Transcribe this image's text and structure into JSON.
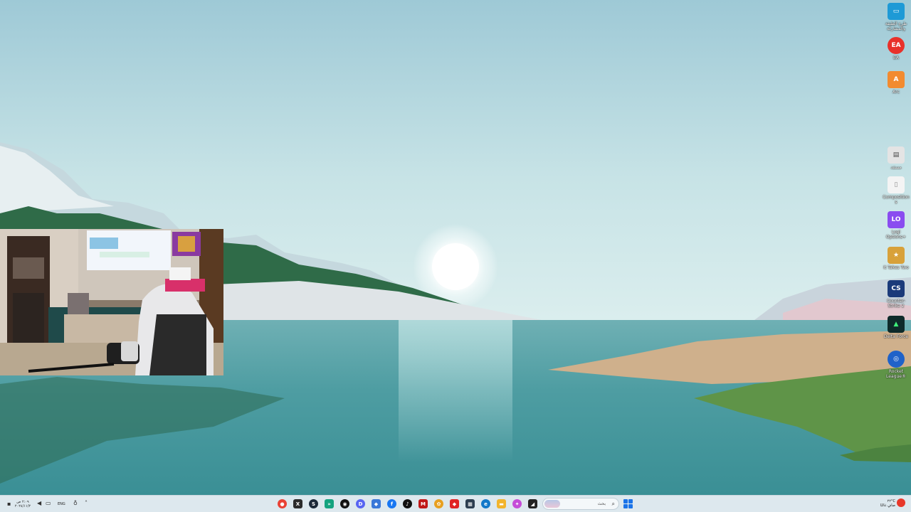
{
  "desktop": {
    "icons": [
      {
        "label": "طرح الطبقة والمشاركة",
        "icon": "monitor-icon",
        "color": "#1e9ad6"
      },
      {
        "label": "EA",
        "icon": "ea-icon",
        "color": "#e8312a"
      },
      {
        "label": "Arc",
        "icon": "arc-icon",
        "color": "#f28b30"
      },
      {
        "label": "مستند",
        "icon": "document-icon",
        "color": "#e4e4e4"
      },
      {
        "label": "Compositions",
        "icon": "file-icon",
        "color": "#f4f4f4"
      },
      {
        "label": "Logi Options+",
        "icon": "logi-icon",
        "color": "#8a4cf0"
      },
      {
        "label": "It Takes Two",
        "icon": "game-icon",
        "color": "#d8a13a"
      },
      {
        "label": "Counter-Strike 2",
        "icon": "cs2-icon",
        "color": "#1b3a7a"
      },
      {
        "label": "Delta Force",
        "icon": "delta-force-icon",
        "color": "#0e2a2a"
      },
      {
        "label": "Rocket League®",
        "icon": "rocket-league-icon",
        "color": "#1f62c9"
      }
    ]
  },
  "taskbar": {
    "language": "ENG",
    "clock": {
      "time": "٢:٠٩ ص",
      "date": "٢٠٢٤/١١/٢"
    },
    "search_placeholder": "بحث",
    "weather": {
      "temp": "٢٢°C",
      "condition": "صافٍ غالبًا"
    },
    "apps": [
      {
        "name": "chrome-app",
        "color": "#e94235",
        "glyph": "●"
      },
      {
        "name": "xbox-app",
        "color": "#2b2b2b",
        "glyph": "X"
      },
      {
        "name": "steam-app",
        "color": "#1b2838",
        "glyph": "S"
      },
      {
        "name": "terminal-app",
        "color": "#14a37f",
        "glyph": "»"
      },
      {
        "name": "github-app",
        "color": "#111111",
        "glyph": "◉"
      },
      {
        "name": "discord-app",
        "color": "#5865f2",
        "glyph": "D"
      },
      {
        "name": "shield-app",
        "color": "#3a78d8",
        "glyph": "◆"
      },
      {
        "name": "facebook-app",
        "color": "#1877f2",
        "glyph": "f"
      },
      {
        "name": "tiktok-app",
        "color": "#111111",
        "glyph": "♪"
      },
      {
        "name": "mcafee-app",
        "color": "#c01818",
        "glyph": "M"
      },
      {
        "name": "photos-app",
        "color": "#e8a020",
        "glyph": "✿"
      },
      {
        "name": "redgem-app",
        "color": "#e02424",
        "glyph": "◆"
      },
      {
        "name": "calculator-app",
        "color": "#2d3e50",
        "glyph": "▦"
      },
      {
        "name": "edge-app",
        "color": "#1479c9",
        "glyph": "e"
      },
      {
        "name": "file-explorer-app",
        "color": "#f2b42c",
        "glyph": "▬"
      },
      {
        "name": "copilot-app",
        "color": "#c54cd8",
        "glyph": "✦"
      },
      {
        "name": "capture-app",
        "color": "#222222",
        "glyph": "◢"
      }
    ]
  }
}
